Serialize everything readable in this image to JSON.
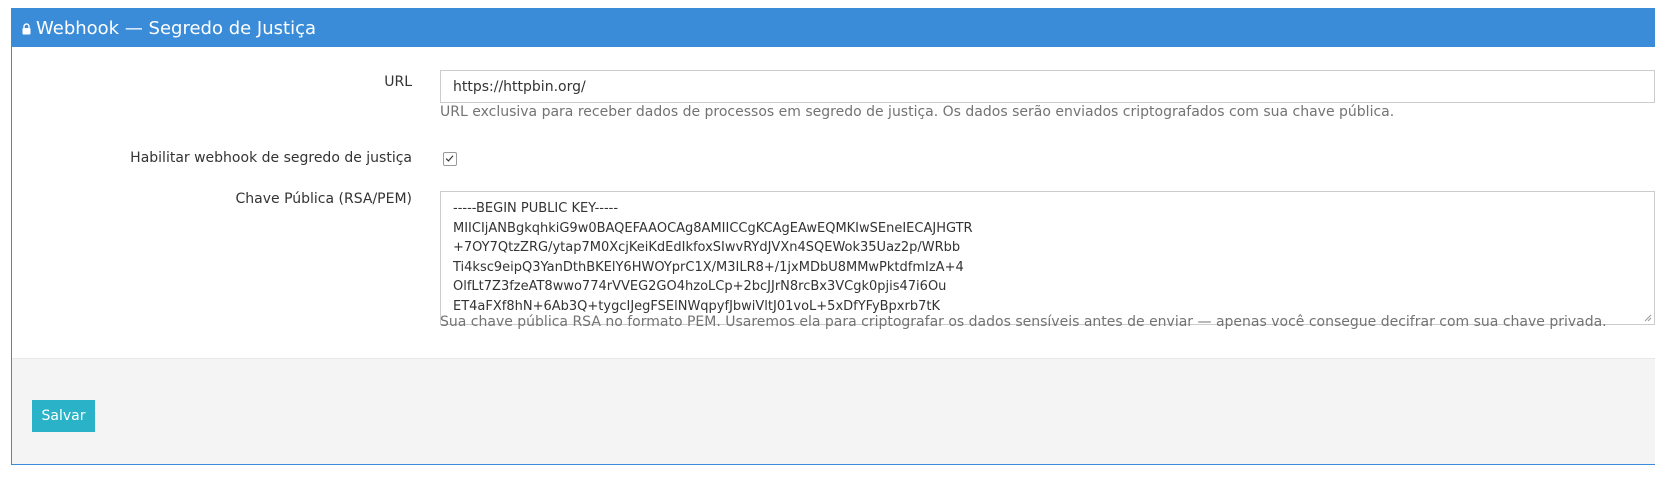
{
  "header": {
    "title": "Webhook — Segredo de Justiça",
    "icon": "lock-icon"
  },
  "form": {
    "url": {
      "label": "URL",
      "value": "https://httpbin.org/",
      "help": "URL exclusiva para receber dados de processos em segredo de justiça. Os dados serão enviados criptografados com sua chave pública."
    },
    "enable": {
      "label": "Habilitar webhook de segredo de justiça",
      "checked": true
    },
    "public_key": {
      "label": "Chave Pública (RSA/PEM)",
      "lines": [
        "-----BEGIN PUBLIC KEY-----",
        "MIICIjANBgkqhkiG9w0BAQEFAAOCAg8AMIICCgKCAgEAwEQMKIwSEneIECAJHGTR",
        "+7OY7QtzZRG/ytap7M0XcjKeiKdEdIkfoxSIwvRYdJVXn4SQEWok35Uaz2p/WRbb",
        "Ti4ksc9eipQ3YanDthBKElY6HWOYprC1X/M3ILR8+/1jxMDbU8MMwPktdfmIzA+4",
        "OlfLt7Z3fzeAT8wwo774rVVEG2GO4hzoLCp+2bcJJrN8rcBx3VCgk0pjis47i6Ou",
        "ET4aFXf8hN+6Ab3Q+tygcIJegFSElNWqpyfJbwiVltJ01voL+5xDfYFyBpxrb7tK"
      ],
      "help": "Sua chave pública RSA no formato PEM. Usaremos ela para criptografar os dados sensíveis antes de enviar — apenas você consegue decifrar com sua chave privada."
    }
  },
  "footer": {
    "save_label": "Salvar"
  },
  "colors": {
    "header": "#3a8cd8",
    "save_button": "#2ab3c8"
  }
}
